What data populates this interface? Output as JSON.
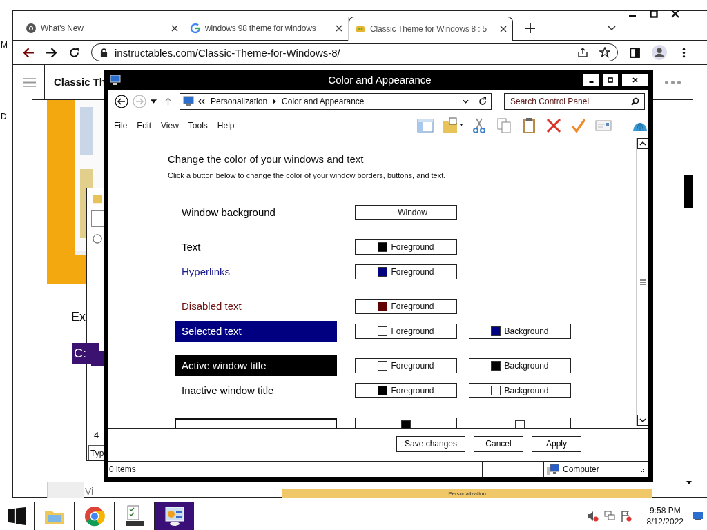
{
  "edge_fragments": [
    "M",
    "D"
  ],
  "browser": {
    "tabs": [
      {
        "title": "What's New",
        "selected": false
      },
      {
        "title": "windows 98 theme for windows",
        "selected": false
      },
      {
        "title": "Classic Theme for Windows 8 : 5",
        "selected": true
      }
    ],
    "url": "instructables.com/Classic-Theme-for-Windows-8/"
  },
  "page": {
    "title": "Classic Th",
    "heading": "Ex",
    "code_prefix": "C:",
    "behind_window": {
      "text": "4",
      "field_value": "Typ"
    },
    "bottom_strip": {
      "text": "Vi",
      "bar_label": "Personalization"
    }
  },
  "dialog": {
    "title": "Color and Appearance",
    "breadcrumbs": [
      "Personalization",
      "Color and Appearance"
    ],
    "search": {
      "placeholder": "Search Control Panel"
    },
    "menu": [
      "File",
      "Edit",
      "View",
      "Tools",
      "Help"
    ],
    "heading": "Change the color of your windows and text",
    "instructions": "Click a button below to change the color of your window borders, buttons, and text.",
    "groups": [
      [
        {
          "label": "Window background",
          "kind": "plain",
          "color": "#000000",
          "swatches": [
            {
              "label": "Window",
              "color": "#ffffff"
            }
          ]
        }
      ],
      [
        {
          "label": "Text",
          "kind": "plain",
          "color": "#000000",
          "swatches": [
            {
              "label": "Foreground",
              "color": "#000000"
            }
          ]
        },
        {
          "label": "Hyperlinks",
          "kind": "plain",
          "color": "#1a1a8c",
          "swatches": [
            {
              "label": "Foreground",
              "color": "#000080"
            }
          ]
        }
      ],
      [
        {
          "label": "Disabled text",
          "kind": "plain",
          "color": "#6d1010",
          "swatches": [
            {
              "label": "Foreground",
              "color": "#600000"
            }
          ]
        },
        {
          "label": "Selected text",
          "kind": "filled",
          "color": "#000080",
          "swatches": [
            {
              "label": "Foreground",
              "color": "#ffffff"
            },
            {
              "label": "Background",
              "color": "#000080"
            }
          ]
        }
      ],
      [
        {
          "label": "Active window title",
          "kind": "filled",
          "color": "#000000",
          "swatches": [
            {
              "label": "Foreground",
              "color": "#ffffff"
            },
            {
              "label": "Background",
              "color": "#000000"
            }
          ]
        },
        {
          "label": "Inactive window title",
          "kind": "plain",
          "color": "#000000",
          "swatches": [
            {
              "label": "Foreground",
              "color": "#000000"
            },
            {
              "label": "Background",
              "color": "#ffffff"
            }
          ]
        }
      ],
      [
        {
          "kind": "framed",
          "swatches": [
            {
              "color": "#000000"
            },
            {
              "color": "#ffffff"
            }
          ]
        }
      ]
    ],
    "buttons": [
      "Save changes",
      "Cancel",
      "Apply"
    ],
    "status": {
      "count": "0 items",
      "location": "Computer"
    }
  },
  "taskbar": {
    "items": [
      {
        "kind": "explorer",
        "selected": false
      },
      {
        "kind": "chrome",
        "selected": false
      },
      {
        "kind": "tasks",
        "selected": false
      },
      {
        "kind": "control-panel",
        "selected": true
      }
    ],
    "time": "9:58 PM",
    "date": "8/12/2022"
  }
}
